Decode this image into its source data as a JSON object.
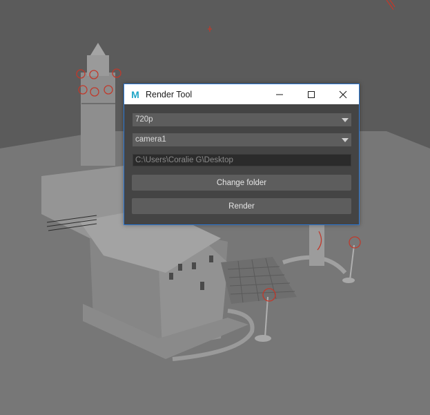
{
  "window": {
    "title": "Render Tool",
    "app_icon_letter": "M"
  },
  "form": {
    "resolution": {
      "selected": "720p"
    },
    "camera": {
      "selected": "camera1"
    },
    "output_folder": "C:\\Users\\Coralie G\\Desktop",
    "change_folder_label": "Change folder",
    "render_label": "Render"
  },
  "icons": {
    "minimize": "minimize-icon",
    "maximize": "maximize-icon",
    "close": "close-icon",
    "dropdown": "chevron-down-icon",
    "app": "maya-app-icon"
  },
  "colors": {
    "viewport_bg": "#5a5a5a",
    "dialog_bg": "#444444",
    "dialog_border": "#2b79d8",
    "accent_icon": "#1fa6c7",
    "selection_red": "#c0392b"
  }
}
